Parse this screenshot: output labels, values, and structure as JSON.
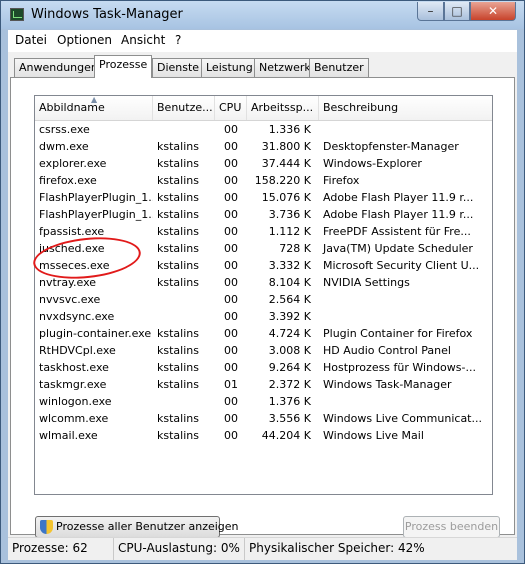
{
  "window": {
    "title": "Windows Task-Manager",
    "min_glyph": "–",
    "max_glyph": "□",
    "close_glyph": "✕"
  },
  "menu": [
    "Datei",
    "Optionen",
    "Ansicht",
    "?"
  ],
  "tabs": [
    "Anwendungen",
    "Prozesse",
    "Dienste",
    "Leistung",
    "Netzwerk",
    "Benutzer"
  ],
  "active_tab": "Prozesse",
  "columns": [
    "Abbildname",
    "Benutze...",
    "CPU",
    "Arbeitssp...",
    "Beschreibung"
  ],
  "sort_arrow": "▲",
  "rows": [
    [
      "csrss.exe",
      "",
      "00",
      "1.336 K",
      ""
    ],
    [
      "dwm.exe",
      "kstalins",
      "00",
      "31.800 K",
      "Desktopfenster-Manager"
    ],
    [
      "explorer.exe",
      "kstalins",
      "00",
      "37.444 K",
      "Windows-Explorer"
    ],
    [
      "firefox.exe",
      "kstalins",
      "00",
      "158.220 K",
      "Firefox"
    ],
    [
      "FlashPlayerPlugin_1...",
      "kstalins",
      "00",
      "15.076 K",
      "Adobe Flash Player 11.9 r..."
    ],
    [
      "FlashPlayerPlugin_1...",
      "kstalins",
      "00",
      "3.736 K",
      "Adobe Flash Player 11.9 r..."
    ],
    [
      "fpassist.exe",
      "kstalins",
      "00",
      "1.112 K",
      "FreePDF Assistent für Fre..."
    ],
    [
      "jusched.exe",
      "kstalins",
      "00",
      "728 K",
      "Java(TM) Update Scheduler"
    ],
    [
      "msseces.exe",
      "kstalins",
      "00",
      "3.332 K",
      "Microsoft Security Client U..."
    ],
    [
      "nvtray.exe",
      "kstalins",
      "00",
      "8.104 K",
      "NVIDIA Settings"
    ],
    [
      "nvvsvc.exe",
      "",
      "00",
      "2.564 K",
      ""
    ],
    [
      "nvxdsync.exe",
      "",
      "00",
      "3.392 K",
      ""
    ],
    [
      "plugin-container.exe",
      "kstalins",
      "00",
      "4.724 K",
      "Plugin Container for Firefox"
    ],
    [
      "RtHDVCpl.exe",
      "kstalins",
      "00",
      "3.008 K",
      "HD Audio Control Panel"
    ],
    [
      "taskhost.exe",
      "kstalins",
      "00",
      "9.264 K",
      "Hostprozess für Windows-..."
    ],
    [
      "taskmgr.exe",
      "kstalins",
      "01",
      "2.372 K",
      "Windows Task-Manager"
    ],
    [
      "winlogon.exe",
      "",
      "00",
      "1.376 K",
      ""
    ],
    [
      "wlcomm.exe",
      "kstalins",
      "00",
      "3.556 K",
      "Windows Live Communicat..."
    ],
    [
      "wlmail.exe",
      "kstalins",
      "00",
      "44.204 K",
      "Windows Live Mail"
    ]
  ],
  "buttons": {
    "show_all": "Prozesse aller Benutzer anzeigen",
    "end_process": "Prozess beenden"
  },
  "status": {
    "processes": "Prozesse: 62",
    "cpu": "CPU-Auslastung: 0%",
    "memory": "Physikalischer Speicher: 42%"
  }
}
